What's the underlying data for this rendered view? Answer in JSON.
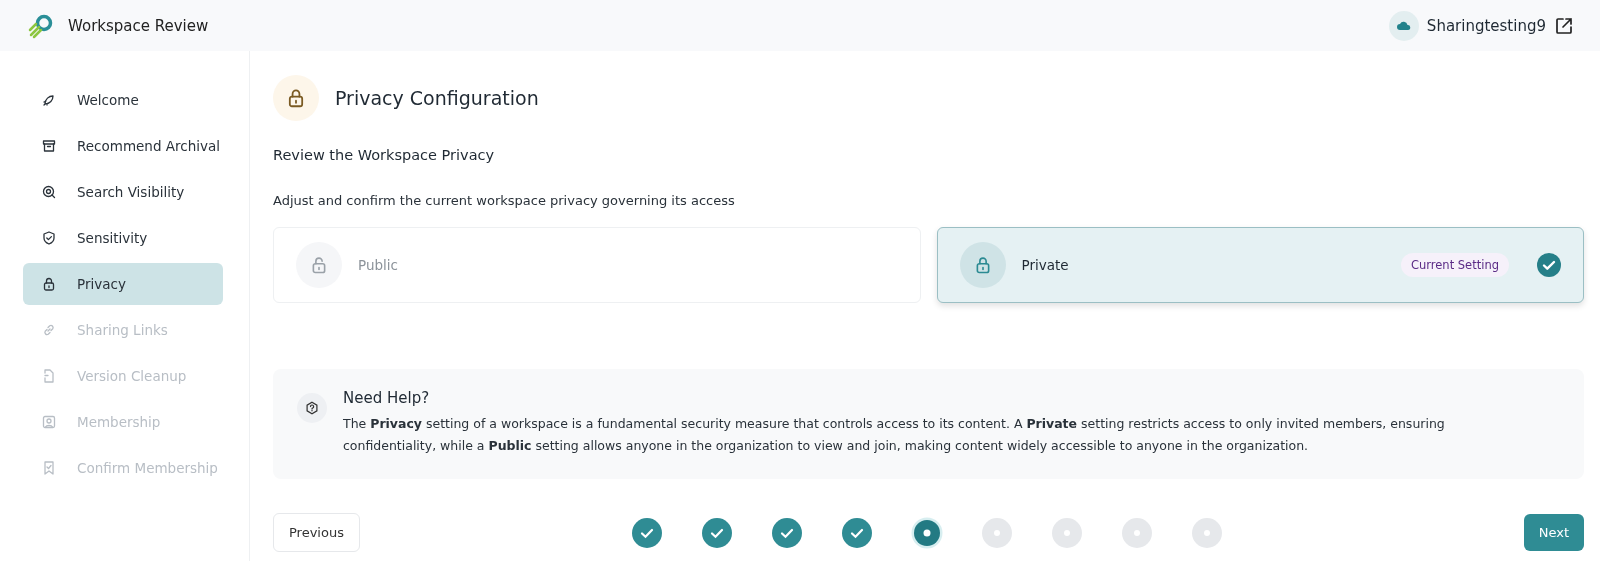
{
  "header": {
    "title": "Workspace Review",
    "workspace": "Sharingtesting9"
  },
  "sidebar": {
    "items": [
      {
        "label": "Welcome",
        "selected": false,
        "disabled": false
      },
      {
        "label": "Recommend Archival",
        "selected": false,
        "disabled": false
      },
      {
        "label": "Search Visibility",
        "selected": false,
        "disabled": false
      },
      {
        "label": "Sensitivity",
        "selected": false,
        "disabled": false
      },
      {
        "label": "Privacy",
        "selected": true,
        "disabled": false
      },
      {
        "label": "Sharing Links",
        "selected": false,
        "disabled": true
      },
      {
        "label": "Version Cleanup",
        "selected": false,
        "disabled": true
      },
      {
        "label": "Membership",
        "selected": false,
        "disabled": true
      },
      {
        "label": "Confirm Membership",
        "selected": false,
        "disabled": true
      }
    ]
  },
  "page": {
    "title": "Privacy Configuration",
    "subtitle": "Review the Workspace Privacy",
    "description": "Adjust and confirm the current workspace privacy governing its access"
  },
  "options": [
    {
      "label": "Public",
      "selected": false
    },
    {
      "label": "Private",
      "selected": true,
      "badge": "Current Setting"
    }
  ],
  "help": {
    "title": "Need Help?",
    "text": "The **Privacy** setting of a workspace is a fundamental security measure that controls access to its content. A **Private** setting restricts access to only invited members, ensuring confidentiality, while a **Public** setting allows anyone in the organization to view and join, making content widely accessible to anyone in the organization."
  },
  "footer": {
    "previous": "Previous",
    "next": "Next",
    "steps": [
      {
        "completed": true,
        "selected": false
      },
      {
        "completed": true,
        "selected": false
      },
      {
        "completed": true,
        "selected": false
      },
      {
        "completed": true,
        "selected": false
      },
      {
        "completed": false,
        "selected": true
      },
      {
        "completed": false,
        "selected": false
      },
      {
        "completed": false,
        "selected": false
      },
      {
        "completed": false,
        "selected": false
      },
      {
        "completed": false,
        "selected": false
      }
    ]
  }
}
